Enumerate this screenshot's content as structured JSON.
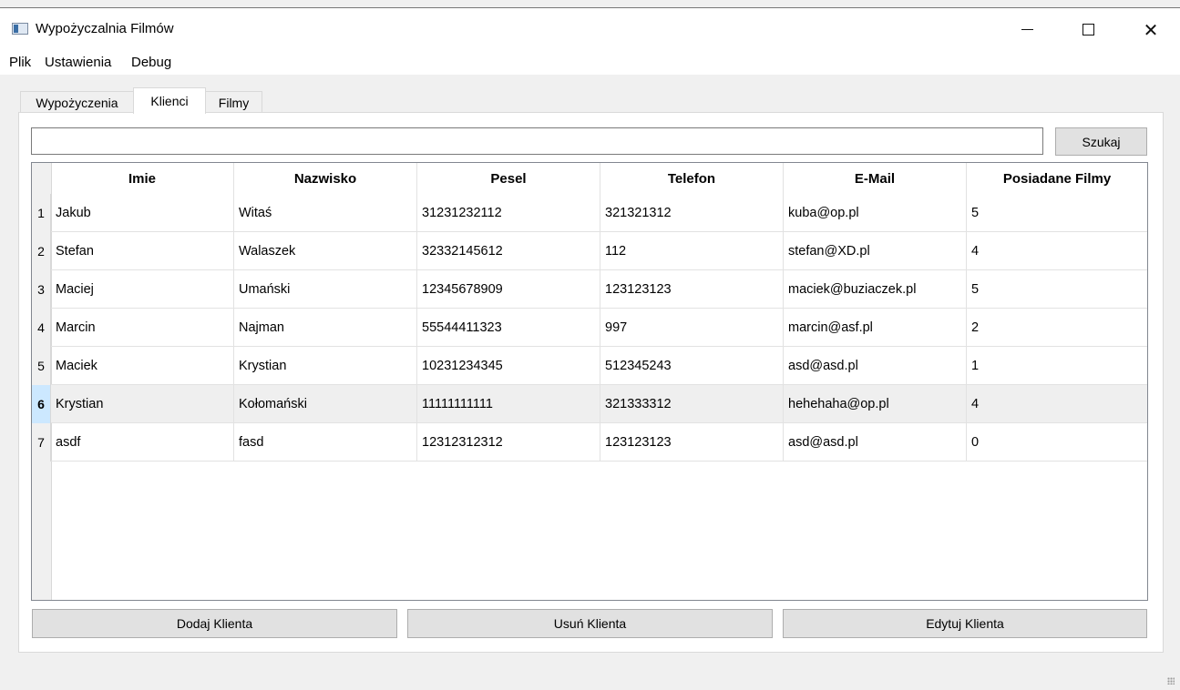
{
  "window": {
    "title": "Wypożyczalnia Filmów",
    "app_icon": "app-window-icon",
    "controls": {
      "minimize_icon": "minimize-icon",
      "maximize_icon": "maximize-icon",
      "close_icon": "close-icon",
      "close_glyph": "✕"
    }
  },
  "menu": {
    "items": [
      "Plik",
      "Ustawienia",
      "Debug"
    ]
  },
  "tabs": [
    {
      "label": "Wypożyczenia",
      "active": false
    },
    {
      "label": "Klienci",
      "active": true
    },
    {
      "label": "Filmy",
      "active": false
    }
  ],
  "search": {
    "value": "",
    "placeholder": "",
    "button_label": "Szukaj"
  },
  "table": {
    "columns": [
      "Imie",
      "Nazwisko",
      "Pesel",
      "Telefon",
      "E-Mail",
      "Posiadane Filmy"
    ],
    "selected_row": 6,
    "rows": [
      {
        "num": "1",
        "cells": [
          "Jakub",
          "Witaś",
          "31231232112",
          "321321312",
          "kuba@op.pl",
          "5"
        ]
      },
      {
        "num": "2",
        "cells": [
          "Stefan",
          "Walaszek",
          "32332145612",
          "112",
          "stefan@XD.pl",
          "4"
        ]
      },
      {
        "num": "3",
        "cells": [
          "Maciej",
          "Umański",
          "12345678909",
          "123123123",
          "maciek@buziaczek.pl",
          "5"
        ]
      },
      {
        "num": "4",
        "cells": [
          "Marcin",
          "Najman",
          "55544411323",
          "997",
          "marcin@asf.pl",
          "2"
        ]
      },
      {
        "num": "5",
        "cells": [
          "Maciek",
          "Krystian",
          "10231234345",
          "512345243",
          "asd@asd.pl",
          "1"
        ]
      },
      {
        "num": "6",
        "cells": [
          "Krystian",
          "Kołomański",
          "11111111111",
          "321333312",
          "hehehaha@op.pl",
          "4"
        ]
      },
      {
        "num": "7",
        "cells": [
          "asdf",
          "fasd",
          "12312312312",
          "123123123",
          "asd@asd.pl",
          "0"
        ]
      }
    ]
  },
  "actions": {
    "add_label": "Dodaj Klienta",
    "delete_label": "Usuń Klienta",
    "edit_label": "Edytuj Klienta"
  },
  "colors": {
    "selection_row_header": "#cce8ff",
    "selected_row": "#efefef",
    "window_bg": "#f0f0f0"
  }
}
